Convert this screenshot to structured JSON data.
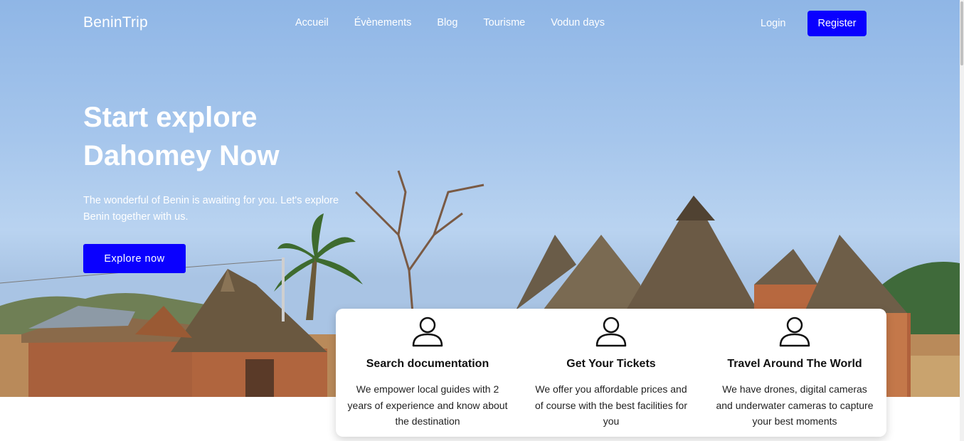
{
  "nav": {
    "brand": "BeninTrip",
    "menu": [
      "Accueil",
      "Évènements",
      "Blog",
      "Tourisme",
      "Vodun days"
    ],
    "login": "Login",
    "register": "Register"
  },
  "hero": {
    "headline_line1": "Start explore",
    "headline_line2": "Dahomey Now",
    "subtitle": "The wonderful of Benin is awaiting for you. Let's explore Benin together with us.",
    "cta": "Explore now"
  },
  "features": [
    {
      "icon": "user-icon",
      "title": "Search documentation",
      "description": "We empower local guides with 2 years of experience and know about the destination"
    },
    {
      "icon": "user-icon",
      "title": "Get Your Tickets",
      "description": "We offer you affordable prices and of course with the best facilities for you"
    },
    {
      "icon": "user-icon",
      "title": "Travel Around The World",
      "description": "We have drones, digital cameras and underwater cameras to capture your best moments"
    }
  ],
  "colors": {
    "accent": "#0a00ff",
    "hero_sky": "#9dbfea"
  }
}
